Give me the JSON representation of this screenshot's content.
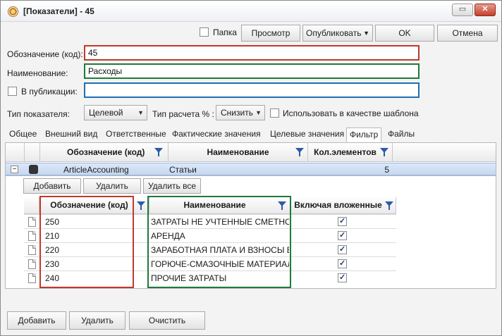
{
  "window": {
    "title": "[Показатели] - 45",
    "minimize_glyph": "▭",
    "close_glyph": "✕"
  },
  "toolbar": {
    "folder_label": "Папка",
    "folder_checked": false,
    "view_label": "Просмотр",
    "publish_label": "Опубликовать",
    "ok_label": "OK",
    "cancel_label": "Отмена"
  },
  "form": {
    "code_label": "Обозначение (код):",
    "code_value": "45",
    "name_label": "Наименование:",
    "name_value": "Расходы",
    "publication_label": "В публикации:",
    "publication_checked": false,
    "publication_value": "",
    "type_label": "Тип показателя:",
    "type_value": "Целевой",
    "calc_label": "Тип расчета % :",
    "calc_value": "Снизить",
    "template_label": "Использовать в качестве шаблона",
    "template_checked": false
  },
  "tabs": [
    {
      "label": "Общее"
    },
    {
      "label": "Внешний вид"
    },
    {
      "label": "Ответственные"
    },
    {
      "label": "Фактические значения"
    },
    {
      "label": "Целевые значения"
    },
    {
      "label": "Фильтр"
    },
    {
      "label": "Файлы"
    }
  ],
  "filter_grid": {
    "columns": [
      "Обозначение (код)",
      "Наименование",
      "Кол.элементов"
    ],
    "rows": [
      {
        "code": "ArticleAccounting",
        "name": "Статьи",
        "count": "5",
        "expand": "−"
      }
    ]
  },
  "sub_toolbar": {
    "add_label": "Добавить",
    "delete_label": "Удалить",
    "delete_all_label": "Удалить все"
  },
  "items_grid": {
    "columns": [
      "Обозначение (код)",
      "Наименование",
      "Включая вложенные"
    ],
    "rows": [
      {
        "code": "250",
        "name": "ЗАТРАТЫ НЕ УЧТЕННЫЕ СМЕТНОЙ",
        "nested": true
      },
      {
        "code": "210",
        "name": "АРЕНДА",
        "nested": true
      },
      {
        "code": "220",
        "name": "ЗАРАБОТНАЯ ПЛАТА И ВЗНОСЫ ВО",
        "nested": true
      },
      {
        "code": "230",
        "name": "ГОРЮЧЕ-СМАЗОЧНЫЕ МАТЕРИАЛ",
        "nested": true
      },
      {
        "code": "240",
        "name": "ПРОЧИЕ ЗАТРАТЫ",
        "nested": true
      }
    ]
  },
  "bottom": {
    "add_label": "Добавить",
    "delete_label": "Удалить",
    "clear_label": "Очистить"
  },
  "colors": {
    "highlight_red": "#c0392b",
    "highlight_green": "#1e7a3c",
    "highlight_blue": "#1f6fb2",
    "selected_row": "#c5d8f1"
  }
}
